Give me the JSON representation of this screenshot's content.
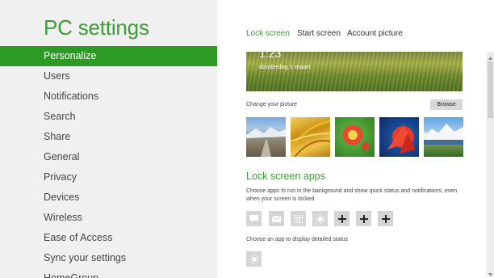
{
  "app": {
    "title": "PC settings"
  },
  "sidebar": {
    "items": [
      {
        "label": "Personalize"
      },
      {
        "label": "Users"
      },
      {
        "label": "Notifications"
      },
      {
        "label": "Search"
      },
      {
        "label": "Share"
      },
      {
        "label": "General"
      },
      {
        "label": "Privacy"
      },
      {
        "label": "Devices"
      },
      {
        "label": "Wireless"
      },
      {
        "label": "Ease of Access"
      },
      {
        "label": "Sync your settings"
      },
      {
        "label": "HomeGroup"
      }
    ],
    "active_index": 0
  },
  "tabs": [
    {
      "label": "Lock screen"
    },
    {
      "label": "Start screen"
    },
    {
      "label": "Account picture"
    }
  ],
  "preview": {
    "time": "1:23",
    "date": "donderdag 1 maart"
  },
  "picture": {
    "change_label": "Change your picture",
    "browse_label": "Browse",
    "thumbnails": [
      "road-landscape",
      "wheat-field",
      "red-flower",
      "red-leaves",
      "mountain-lake"
    ]
  },
  "lock_apps": {
    "title": "Lock screen apps",
    "description": "Choose apps to run in the background and show quick status and notifications, even when your screen is locked",
    "apps": [
      "messaging-icon",
      "mail-icon",
      "calendar-icon",
      "weather-icon",
      "add-icon",
      "add-icon",
      "add-icon"
    ],
    "detailed_label": "Choose an app to display detailed status",
    "detailed_app": "weather-icon"
  },
  "colors": {
    "accent": "#3a9e35",
    "nav_active_bg": "#2e9a26",
    "sidebar_bg": "#f0f0f0",
    "slot_bg": "#d5d5d5"
  }
}
